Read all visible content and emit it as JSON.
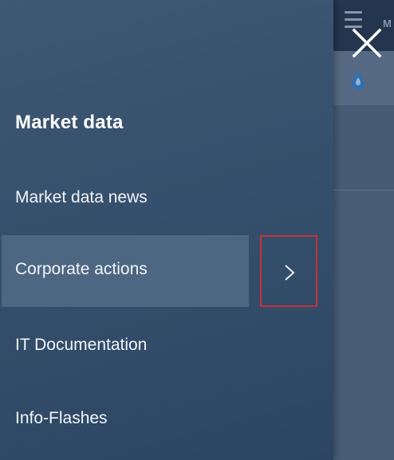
{
  "menu": {
    "heading": "Market data",
    "items": [
      {
        "label": "Market data news"
      },
      {
        "label": "Corporate actions",
        "active": true
      },
      {
        "label": "IT Documentation"
      },
      {
        "label": "Info-Flashes"
      }
    ]
  },
  "background": {
    "topbar_text": "M"
  },
  "icons": {
    "close": "close-icon",
    "expand": "chevron-right-icon",
    "menu": "hamburger-icon",
    "drop": "drop-icon"
  },
  "colors": {
    "panel": "#3a5471",
    "highlight": "#4d6681",
    "focus_outline": "#c8303a",
    "text": "#ffffff"
  }
}
